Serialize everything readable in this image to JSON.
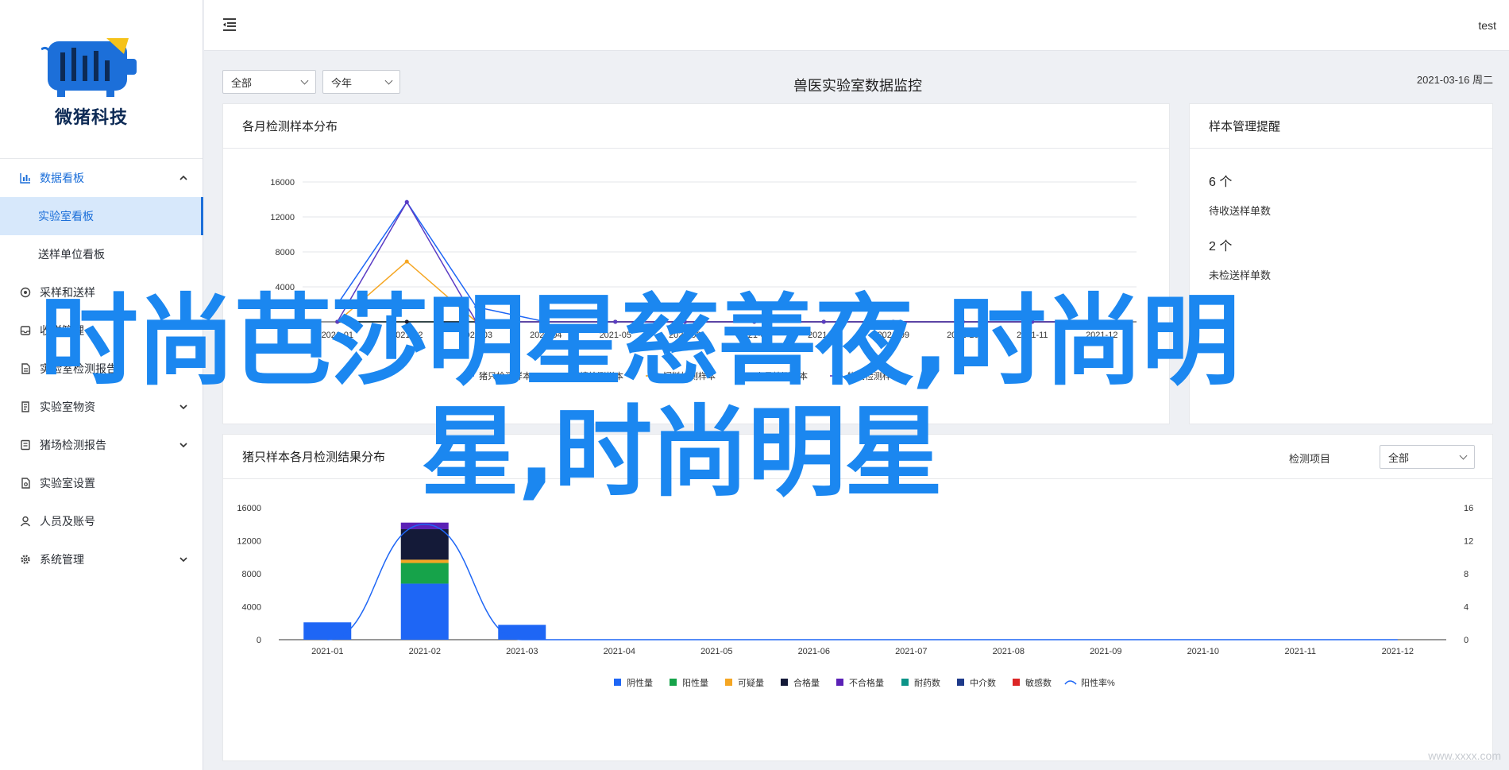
{
  "brand": {
    "name": "微猪科技",
    "colors": {
      "primary": "#1c6fd9",
      "logo_dark": "#0d2a55",
      "logo_yellow": "#f5c21a"
    }
  },
  "header": {
    "user": "test"
  },
  "sidebar": {
    "items": [
      {
        "label": "数据看板",
        "icon": "bar-chart-icon",
        "expanded": true,
        "children": [
          {
            "label": "实验室看板",
            "selected": true
          },
          {
            "label": "送样单位看板"
          }
        ]
      },
      {
        "label": "采样和送样",
        "icon": "sample-icon"
      },
      {
        "label": "收样管理",
        "icon": "inbox-icon"
      },
      {
        "label": "实验室检测报告",
        "icon": "report-icon"
      },
      {
        "label": "实验室物资",
        "icon": "materials-icon",
        "has_children": true
      },
      {
        "label": "猪场检测报告",
        "icon": "farm-report-icon",
        "has_children": true
      },
      {
        "label": "实验室设置",
        "icon": "lab-settings-icon"
      },
      {
        "label": "人员及账号",
        "icon": "user-icon"
      },
      {
        "label": "系统管理",
        "icon": "gear-icon",
        "has_children": true
      }
    ]
  },
  "filters": {
    "scope": "全部",
    "period": "今年"
  },
  "page": {
    "title": "兽医实验室数据监控",
    "date": "2021-03-16 周二"
  },
  "card1": {
    "title": "各月检测样本分布",
    "legend": [
      "猪只检测样本",
      "环境检测样本",
      "饲料检测样本",
      "人员检测样本",
      "物资检测样本"
    ]
  },
  "card2": {
    "title": "样本管理提醒",
    "stats": [
      {
        "value": "6 个",
        "label": "待收送样单数"
      },
      {
        "value": "2 个",
        "label": "未检送样单数"
      }
    ]
  },
  "card3": {
    "title": "猪只样本各月检测结果分布",
    "filter_label": "检测项目",
    "filter_value": "全部",
    "legend": [
      "阴性量",
      "阳性量",
      "可疑量",
      "合格量",
      "不合格量",
      "耐药数",
      "中介数",
      "敏感数",
      "阳性率%"
    ]
  },
  "overlay": {
    "line1": "时尚芭莎明星慈善夜,时尚明",
    "line2": "星,时尚明星"
  },
  "corner": "www.xxxx.com",
  "chart_data": [
    {
      "type": "line",
      "title": "各月检测样本分布",
      "categories": [
        "2021-01",
        "2021-02",
        "2021-03",
        "2021-04",
        "2021-05",
        "2021-06",
        "2021-07",
        "2021-08",
        "2021-09",
        "2021-10",
        "2021-11",
        "2021-12"
      ],
      "ylim": [
        0,
        16000
      ],
      "yticks": [
        0,
        4000,
        8000,
        12000,
        16000
      ],
      "series": [
        {
          "name": "猪只检测样本",
          "color": "#1e66f5",
          "values": [
            2000,
            13700,
            1700,
            0,
            0,
            0,
            0,
            0,
            0,
            0,
            0,
            0
          ]
        },
        {
          "name": "环境检测样本",
          "color": "#16a34a",
          "values": [
            0,
            0,
            0,
            0,
            0,
            0,
            0,
            0,
            0,
            0,
            0,
            0
          ]
        },
        {
          "name": "饲料检测样本",
          "color": "#f5a623",
          "values": [
            0,
            6900,
            0,
            0,
            0,
            0,
            0,
            0,
            0,
            0,
            0,
            0
          ]
        },
        {
          "name": "人员检测样本",
          "color": "#1a1a2e",
          "values": [
            0,
            0,
            0,
            0,
            0,
            0,
            0,
            0,
            0,
            0,
            0,
            0
          ]
        },
        {
          "name": "物资检测样本",
          "color": "#5b3cc4",
          "values": [
            0,
            13700,
            0,
            0,
            0,
            0,
            0,
            0,
            0,
            0,
            0,
            0
          ]
        }
      ],
      "grid": true,
      "legend": "bottom"
    },
    {
      "type": "bar",
      "title": "猪只样本各月检测结果分布",
      "categories": [
        "2021-01",
        "2021-02",
        "2021-03",
        "2021-04",
        "2021-05",
        "2021-06",
        "2021-07",
        "2021-08",
        "2021-09",
        "2021-10",
        "2021-11",
        "2021-12"
      ],
      "ylim": [
        0,
        16000
      ],
      "yticks": [
        0,
        4000,
        8000,
        12000,
        16000
      ],
      "y2lim": [
        0,
        16
      ],
      "y2ticks": [
        0,
        4,
        8,
        12,
        16
      ],
      "stacked": true,
      "series": [
        {
          "name": "阴性量",
          "color": "#1e66f5",
          "values": [
            2100,
            6800,
            1800,
            0,
            0,
            0,
            0,
            0,
            0,
            0,
            0,
            0
          ]
        },
        {
          "name": "阳性量",
          "color": "#16a34a",
          "values": [
            0,
            2500,
            0,
            0,
            0,
            0,
            0,
            0,
            0,
            0,
            0,
            0
          ]
        },
        {
          "name": "可疑量",
          "color": "#f5a623",
          "values": [
            0,
            400,
            0,
            0,
            0,
            0,
            0,
            0,
            0,
            0,
            0,
            0
          ]
        },
        {
          "name": "合格量",
          "color": "#141a38",
          "values": [
            0,
            3700,
            0,
            0,
            0,
            0,
            0,
            0,
            0,
            0,
            0,
            0
          ]
        },
        {
          "name": "不合格量",
          "color": "#5b21b6",
          "values": [
            0,
            800,
            0,
            0,
            0,
            0,
            0,
            0,
            0,
            0,
            0,
            0
          ]
        },
        {
          "name": "耐药数",
          "color": "#0d9488",
          "values": [
            0,
            0,
            0,
            0,
            0,
            0,
            0,
            0,
            0,
            0,
            0,
            0
          ]
        },
        {
          "name": "中介数",
          "color": "#1e3a8a",
          "values": [
            0,
            0,
            0,
            0,
            0,
            0,
            0,
            0,
            0,
            0,
            0,
            0
          ]
        },
        {
          "name": "敏感数",
          "color": "#dc2626",
          "values": [
            0,
            0,
            0,
            0,
            0,
            0,
            0,
            0,
            0,
            0,
            0,
            0
          ]
        }
      ],
      "line_series": {
        "name": "阳性率%",
        "color": "#1e66f5",
        "axis": "right",
        "values": [
          0,
          14,
          0,
          0,
          0,
          0,
          0,
          0,
          0,
          0,
          0,
          0
        ]
      },
      "grid": false,
      "legend": "bottom"
    }
  ]
}
